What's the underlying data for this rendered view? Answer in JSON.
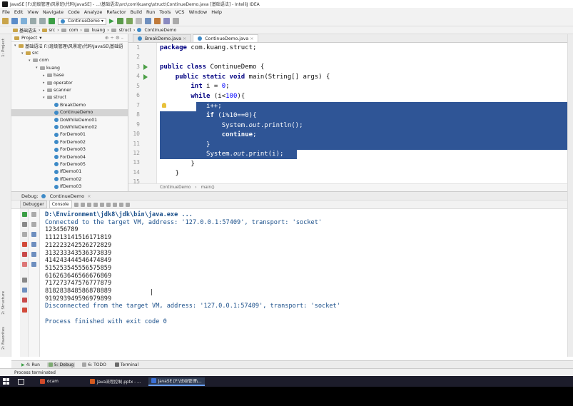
{
  "window": {
    "title": "JavaSE [F:\\班级管理\\风景班\\代码\\JavaSE] - ...\\基础语法\\src\\com\\kuang\\struct\\ContinueDemo.java [基础语法] - IntelliJ IDEA"
  },
  "menu": [
    "File",
    "Edit",
    "View",
    "Navigate",
    "Code",
    "Analyze",
    "Refactor",
    "Build",
    "Run",
    "Tools",
    "VCS",
    "Window",
    "Help"
  ],
  "toolbar": {
    "run_config": "ContinueDemo"
  },
  "navbar": [
    "基础语法",
    "src",
    "com",
    "kuang",
    "struct",
    "ContinueDemo"
  ],
  "left_strip": {
    "project_tab": "1: Project",
    "structure_tab": "2: Structure",
    "favorites_tab": "2: Favorites"
  },
  "project": {
    "header": "Project",
    "tree": [
      {
        "label": "基础语法  F:\\班级管理\\风景班\\代码\\JavaSE\\基础语",
        "indent": 0,
        "kind": "module",
        "arrow": "▾"
      },
      {
        "label": "src",
        "indent": 1,
        "kind": "folder",
        "arrow": "▾"
      },
      {
        "label": "com",
        "indent": 2,
        "kind": "pkg",
        "arrow": "▾"
      },
      {
        "label": "kuang",
        "indent": 3,
        "kind": "pkg",
        "arrow": "▾"
      },
      {
        "label": "base",
        "indent": 4,
        "kind": "pkg",
        "arrow": "▸"
      },
      {
        "label": "operator",
        "indent": 4,
        "kind": "pkg",
        "arrow": "▸"
      },
      {
        "label": "scanner",
        "indent": 4,
        "kind": "pkg",
        "arrow": "▸"
      },
      {
        "label": "struct",
        "indent": 4,
        "kind": "pkg",
        "arrow": "▾"
      },
      {
        "label": "BreakDemo",
        "indent": 5,
        "kind": "cls",
        "arrow": ""
      },
      {
        "label": "ContinueDemo",
        "indent": 5,
        "kind": "cls",
        "arrow": "",
        "selected": true
      },
      {
        "label": "DoWhileDemo01",
        "indent": 5,
        "kind": "cls",
        "arrow": ""
      },
      {
        "label": "DoWhileDemo02",
        "indent": 5,
        "kind": "cls",
        "arrow": ""
      },
      {
        "label": "ForDemo01",
        "indent": 5,
        "kind": "cls",
        "arrow": ""
      },
      {
        "label": "ForDemo02",
        "indent": 5,
        "kind": "cls",
        "arrow": ""
      },
      {
        "label": "ForDemo03",
        "indent": 5,
        "kind": "cls",
        "arrow": ""
      },
      {
        "label": "ForDemo04",
        "indent": 5,
        "kind": "cls",
        "arrow": ""
      },
      {
        "label": "ForDemo05",
        "indent": 5,
        "kind": "cls",
        "arrow": ""
      },
      {
        "label": "IfDemo01",
        "indent": 5,
        "kind": "cls",
        "arrow": ""
      },
      {
        "label": "IfDemo02",
        "indent": 5,
        "kind": "cls",
        "arrow": ""
      },
      {
        "label": "IfDemo03",
        "indent": 5,
        "kind": "cls",
        "arrow": ""
      }
    ]
  },
  "editor": {
    "tabs": [
      {
        "label": "BreakDemo.java",
        "active": false
      },
      {
        "label": "ContinueDemo.java",
        "active": true
      }
    ],
    "lines": [
      "1",
      "2",
      "3",
      "4",
      "5",
      "6",
      "7",
      "8",
      "9",
      "10",
      "11",
      "12",
      "13",
      "14",
      "15"
    ],
    "breadcrumb": [
      "ContinueDemo",
      "main()"
    ]
  },
  "debug": {
    "title": "Debug:",
    "config_tab": "ContinueDemo",
    "tabs": [
      "Debugger",
      "Console"
    ]
  },
  "console": {
    "lines": [
      {
        "text": "D:\\Environment\\jdk8\\jdk\\bin\\java.exe ...",
        "kind": "sys bold"
      },
      {
        "text": "Connected to the target VM, address: '127.0.0.1:57409', transport: 'socket'",
        "kind": "sys"
      },
      {
        "text": "123456789",
        "kind": ""
      },
      {
        "text": "111213141516171819",
        "kind": ""
      },
      {
        "text": "212223242526272829",
        "kind": ""
      },
      {
        "text": "313233343536373839",
        "kind": ""
      },
      {
        "text": "414243444546474849",
        "kind": ""
      },
      {
        "text": "515253545556575859",
        "kind": ""
      },
      {
        "text": "616263646566676869",
        "kind": ""
      },
      {
        "text": "717273747576777879",
        "kind": ""
      },
      {
        "text": "818283848586878889",
        "kind": ""
      },
      {
        "text": "919293949596979899",
        "kind": ""
      },
      {
        "text": "Disconnected from the target VM, address: '127.0.0.1:57409', transport: 'socket'",
        "kind": "sys"
      },
      {
        "text": "",
        "kind": ""
      },
      {
        "text": "Process finished with exit code 0",
        "kind": "sys"
      }
    ]
  },
  "bottom_tools": [
    {
      "label": "4: Run",
      "active": false
    },
    {
      "label": "5: Debug",
      "active": true
    },
    {
      "label": "6: TODO",
      "active": false
    },
    {
      "label": "Terminal",
      "active": false
    }
  ],
  "status": {
    "text": "Process terminated"
  },
  "taskbar": [
    {
      "label": "ocam",
      "active": false,
      "color": "#d04a2a"
    },
    {
      "label": "Java流程控制.pptx - ...",
      "active": false,
      "color": "#d35a1f"
    },
    {
      "label": "JavaSE [F:\\班级管理\\...",
      "active": true,
      "color": "#3b6fd6"
    }
  ]
}
